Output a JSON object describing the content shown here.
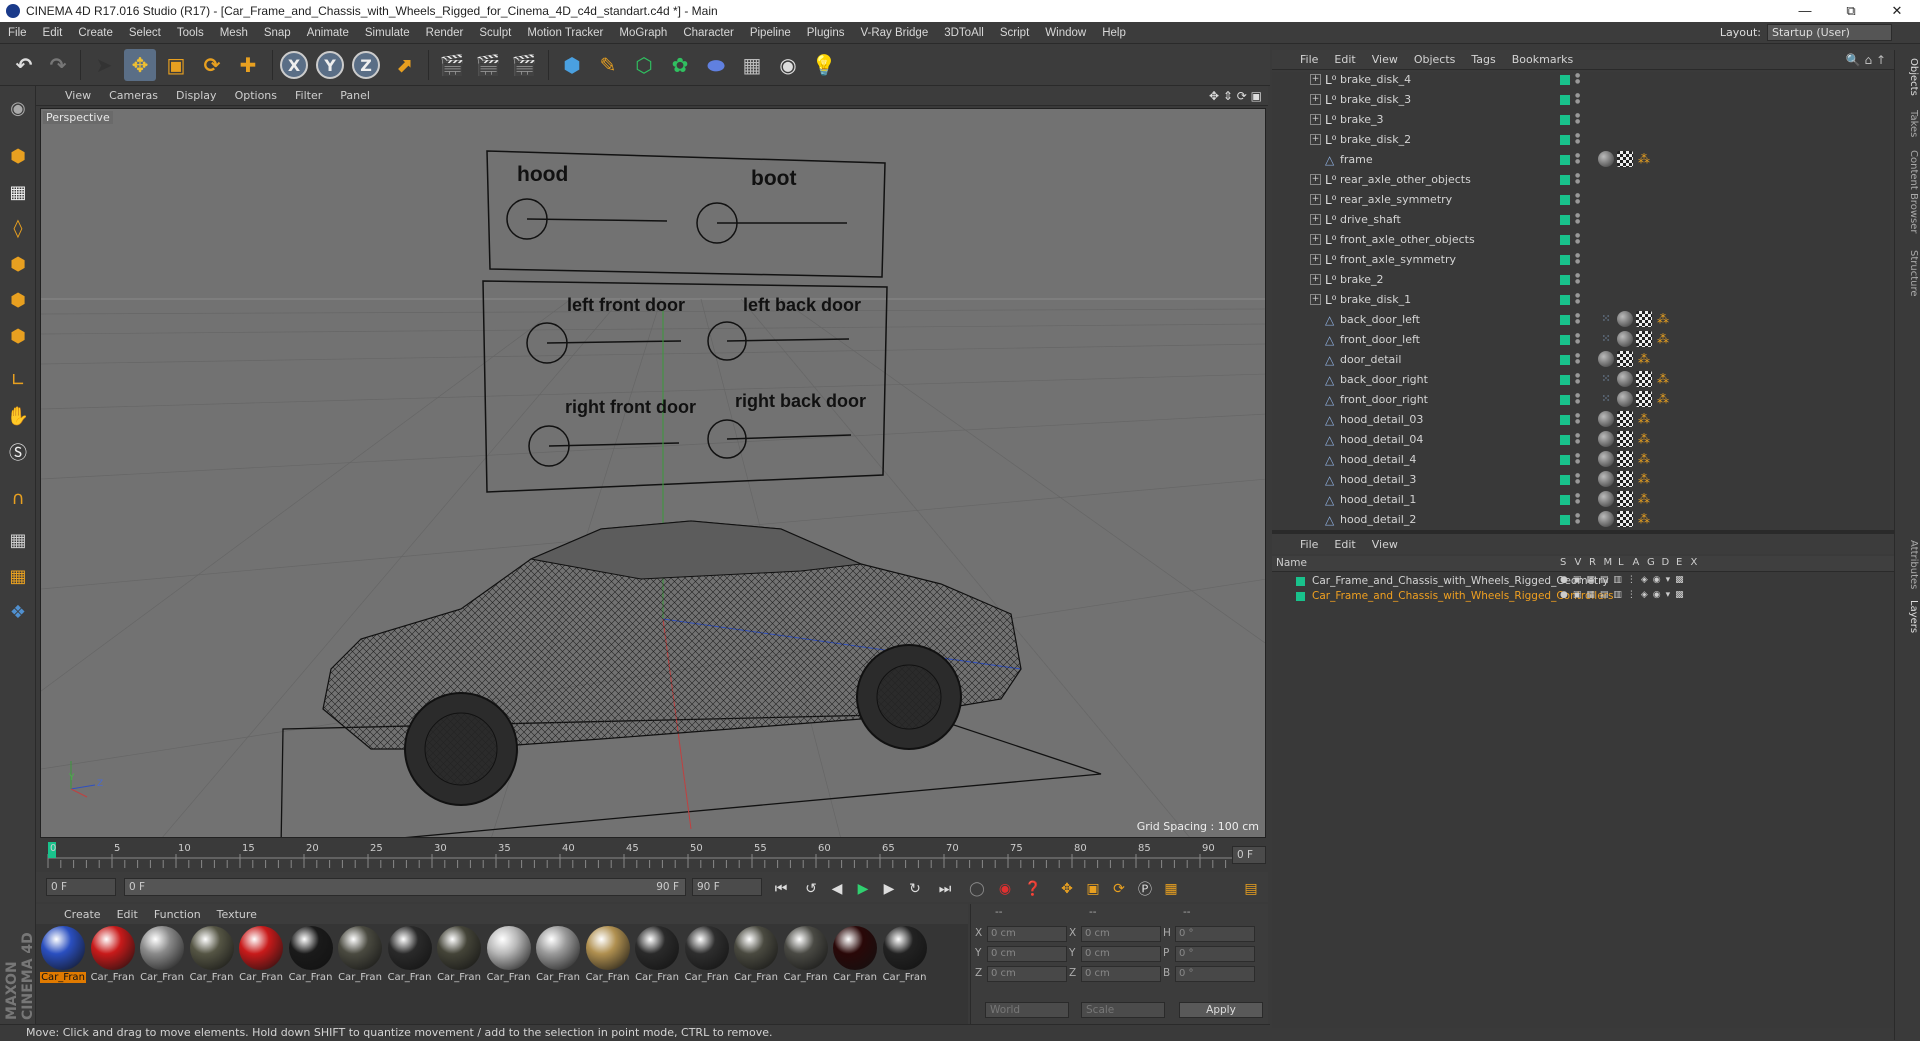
{
  "window": {
    "title": "CINEMA 4D R17.016 Studio (R17) - [Car_Frame_and_Chassis_with_Wheels_Rigged_for_Cinema_4D_c4d_standart.c4d *] - Main"
  },
  "menubar": {
    "items": [
      "File",
      "Edit",
      "Create",
      "Select",
      "Tools",
      "Mesh",
      "Snap",
      "Animate",
      "Simulate",
      "Render",
      "Sculpt",
      "Motion Tracker",
      "MoGraph",
      "Character",
      "Pipeline",
      "Plugins",
      "V-Ray Bridge",
      "3DToAll",
      "Script",
      "Window",
      "Help"
    ],
    "layout_label": "Layout:",
    "layout_value": "Startup (User)"
  },
  "toolbar": {
    "axis_x": "X",
    "axis_y": "Y",
    "axis_z": "Z"
  },
  "viewport": {
    "menu": [
      "View",
      "Cameras",
      "Display",
      "Options",
      "Filter",
      "Panel"
    ],
    "camera_label": "Perspective",
    "grid_spacing": "Grid Spacing : 100 cm",
    "controls": {
      "hood": "hood",
      "boot": "boot",
      "left_front_door": "left front door",
      "left_back_door": "left back door",
      "right_front_door": "right front door",
      "right_back_door": "right back door"
    },
    "axes": {
      "y": "Y",
      "x": "X",
      "z": "Z"
    }
  },
  "timeline": {
    "ticks": [
      "0",
      "5",
      "10",
      "15",
      "20",
      "25",
      "30",
      "35",
      "40",
      "45",
      "50",
      "55",
      "60",
      "65",
      "70",
      "75",
      "80",
      "85",
      "90"
    ],
    "current_frame": "0 F",
    "start_frame": "0 F",
    "range_start": "0 F",
    "range_end": "90 F",
    "end_frame": "90 F"
  },
  "materials": {
    "menu": [
      "Create",
      "Edit",
      "Function",
      "Texture"
    ],
    "items": [
      {
        "label": "Car_Fran",
        "color": "#2a4fc0",
        "active": true
      },
      {
        "label": "Car_Fran",
        "color": "#c81a1a"
      },
      {
        "label": "Car_Fran",
        "color": "#8a8a8a"
      },
      {
        "label": "Car_Fran",
        "color": "#555544"
      },
      {
        "label": "Car_Fran",
        "color": "#c81a1a"
      },
      {
        "label": "Car_Fran",
        "color": "#1a1a1a"
      },
      {
        "label": "Car_Fran",
        "color": "#4a4a40"
      },
      {
        "label": "Car_Fran",
        "color": "#2a2a2a"
      },
      {
        "label": "Car_Fran",
        "color": "#444438"
      },
      {
        "label": "Car_Fran",
        "color": "#b8b8b8"
      },
      {
        "label": "Car_Fran",
        "color": "#9a9a9a"
      },
      {
        "label": "Car_Fran",
        "color": "#b09050"
      },
      {
        "label": "Car_Fran",
        "color": "#2a2a2a"
      },
      {
        "label": "Car_Fran",
        "color": "#2e2e2e"
      },
      {
        "label": "Car_Fran",
        "color": "#4a4a40"
      },
      {
        "label": "Car_Fran",
        "color": "#4a4a44"
      },
      {
        "label": "Car_Fran",
        "color": "#2a0808"
      },
      {
        "label": "Car_Fran",
        "color": "#222222"
      }
    ]
  },
  "coordinates": {
    "header": [
      "--",
      "--",
      "--"
    ],
    "rows": [
      {
        "a": "X",
        "av": "0 cm",
        "b": "X",
        "bv": "0 cm",
        "c": "H",
        "cv": "0 °"
      },
      {
        "a": "Y",
        "av": "0 cm",
        "b": "Y",
        "bv": "0 cm",
        "c": "P",
        "cv": "0 °"
      },
      {
        "a": "Z",
        "av": "0 cm",
        "b": "Z",
        "bv": "0 cm",
        "c": "B",
        "cv": "0 °"
      }
    ],
    "world": "World",
    "scale": "Scale",
    "apply": "Apply"
  },
  "status": "Move: Click and drag to move elements. Hold down SHIFT to quantize movement / add to the selection in point mode, CTRL to remove.",
  "object_manager": {
    "menu": [
      "File",
      "Edit",
      "View",
      "Objects",
      "Tags",
      "Bookmarks"
    ],
    "objects": [
      {
        "name": "brake_disk_4",
        "type": "null",
        "tags": []
      },
      {
        "name": "brake_disk_3",
        "type": "null",
        "tags": []
      },
      {
        "name": "brake_3",
        "type": "null",
        "tags": []
      },
      {
        "name": "brake_disk_2",
        "type": "null",
        "tags": []
      },
      {
        "name": "frame",
        "type": "poly",
        "tags": [
          "sphere",
          "chk",
          "ik"
        ]
      },
      {
        "name": "rear_axle_other_objects",
        "type": "null",
        "tags": []
      },
      {
        "name": "rear_axle_symmetry",
        "type": "null",
        "tags": []
      },
      {
        "name": "drive_shaft",
        "type": "null",
        "tags": []
      },
      {
        "name": "front_axle_other_objects",
        "type": "null",
        "tags": []
      },
      {
        "name": "front_axle_symmetry",
        "type": "null",
        "tags": []
      },
      {
        "name": "brake_2",
        "type": "null",
        "tags": []
      },
      {
        "name": "brake_disk_1",
        "type": "null",
        "tags": []
      },
      {
        "name": "back_door_left",
        "type": "poly",
        "tags": [
          "dotgrid",
          "sphere",
          "chk",
          "ik"
        ]
      },
      {
        "name": "front_door_left",
        "type": "poly",
        "tags": [
          "dotgrid",
          "sphere",
          "chk",
          "ik"
        ]
      },
      {
        "name": "door_detail",
        "type": "poly",
        "tags": [
          "sphere",
          "chk",
          "ik"
        ]
      },
      {
        "name": "back_door_right",
        "type": "poly",
        "tags": [
          "dotgrid",
          "sphere",
          "chk",
          "ik"
        ]
      },
      {
        "name": "front_door_right",
        "type": "poly",
        "tags": [
          "dotgrid",
          "sphere",
          "chk",
          "ik"
        ]
      },
      {
        "name": "hood_detail_03",
        "type": "poly",
        "tags": [
          "sphere",
          "chk",
          "ik"
        ]
      },
      {
        "name": "hood_detail_04",
        "type": "poly",
        "tags": [
          "sphere",
          "chk",
          "ik"
        ]
      },
      {
        "name": "hood_detail_4",
        "type": "poly",
        "tags": [
          "sphere",
          "chk",
          "ik"
        ]
      },
      {
        "name": "hood_detail_3",
        "type": "poly",
        "tags": [
          "sphere",
          "chk",
          "ik"
        ]
      },
      {
        "name": "hood_detail_1",
        "type": "poly",
        "tags": [
          "sphere",
          "chk",
          "ik"
        ]
      },
      {
        "name": "hood_detail_2",
        "type": "poly",
        "tags": [
          "sphere",
          "chk",
          "ik"
        ]
      }
    ]
  },
  "layer_manager": {
    "menu": [
      "File",
      "Edit",
      "View"
    ],
    "header_name": "Name",
    "header_cols": [
      "S",
      "V",
      "R",
      "M",
      "L",
      "A",
      "G",
      "D",
      "E",
      "X"
    ],
    "layers": [
      {
        "name": "Car_Frame_and_Chassis_with_Wheels_Rigged_Geometry",
        "color": "#d4d4d4"
      },
      {
        "name": "Car_Frame_and_Chassis_with_Wheels_Rigged_Controllers",
        "color": "#f0a020"
      }
    ]
  },
  "side_tabs": [
    "Objects",
    "Takes",
    "Content Browser",
    "Structure",
    "Attributes",
    "Layers"
  ],
  "logo": "MAXON CINEMA 4D"
}
